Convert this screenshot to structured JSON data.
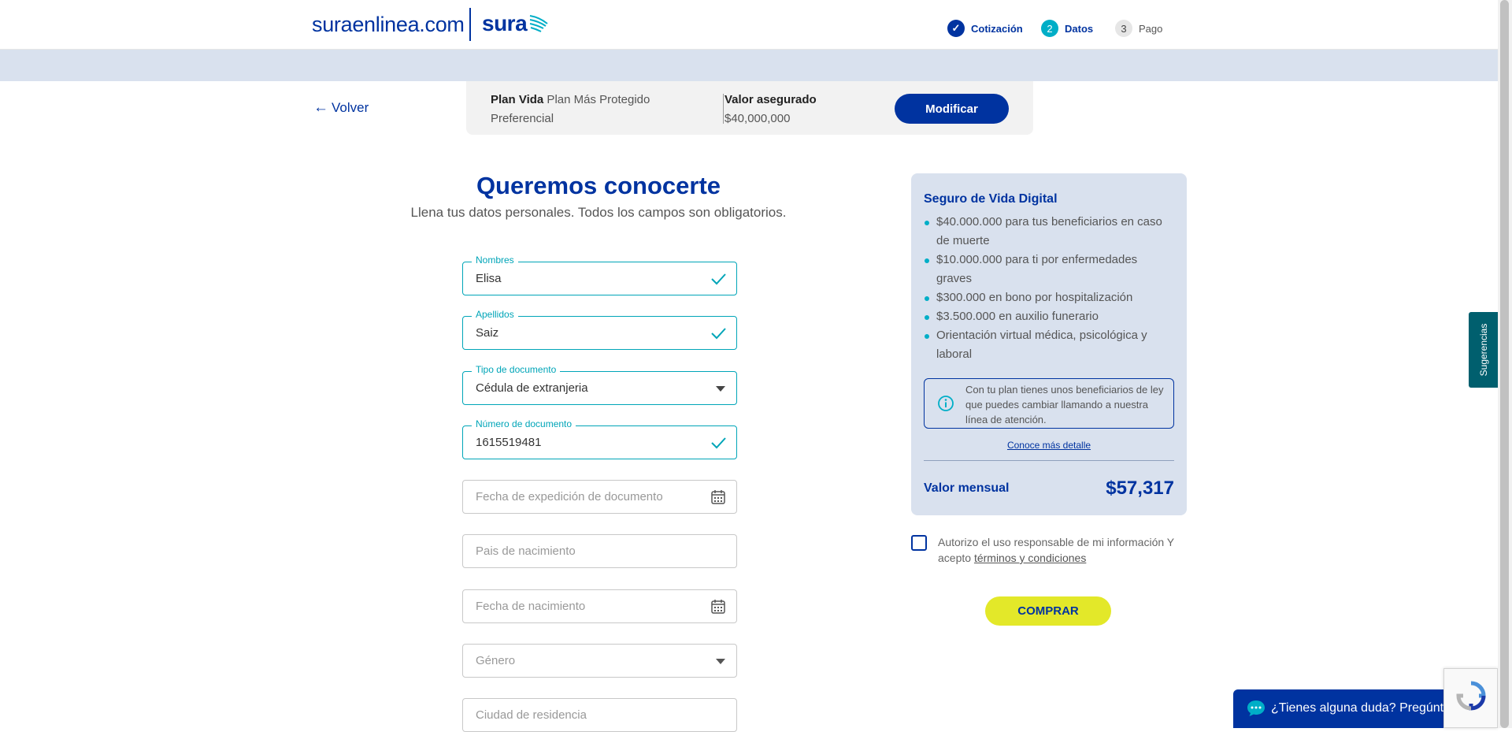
{
  "header": {
    "logo_text": "suraenlinea.com",
    "logo_brand": "sura",
    "steps": [
      {
        "number": "✓",
        "label": "Cotización"
      },
      {
        "number": "2",
        "label": "Datos"
      },
      {
        "number": "3",
        "label": "Pago"
      }
    ]
  },
  "nav": {
    "back_label": "Volver"
  },
  "plan": {
    "name_bold": "Plan Vida",
    "name_rest": " Plan Más Protegido Preferencial",
    "value_label": "Valor asegurado",
    "value": "$40,000,000",
    "modify_label": "Modificar"
  },
  "form": {
    "title": "Queremos conocerte",
    "subtitle": "Llena tus datos personales. Todos los campos son obligatorios.",
    "fields": [
      {
        "label": "Nombres",
        "value": "Elisa"
      },
      {
        "label": "Apellidos",
        "value": "Saiz"
      },
      {
        "label": "Tipo de documento",
        "value": "Cédula de extranjeria"
      },
      {
        "label": "Número de documento",
        "value": "1615519481"
      },
      {
        "placeholder": "Fecha de expedición de documento"
      },
      {
        "placeholder": "Pais de nacimiento"
      },
      {
        "placeholder": "Fecha de nacimiento"
      },
      {
        "placeholder": "Género"
      },
      {
        "placeholder": "Ciudad de residencia"
      }
    ]
  },
  "card": {
    "title": "Seguro de Vida Digital",
    "benefits": [
      "$40.000.000 para tus beneficiarios en caso de muerte",
      "$10.000.000 para ti por enfermedades graves",
      "$300.000 en bono por hospitalización",
      "$3.500.000 en auxilio funerario",
      "Orientación virtual médica, psicológica y laboral"
    ],
    "info": "Con tu plan tienes unos beneficiarios de ley que puedes cambiar llamando a nuestra línea de atención.",
    "more_link": "Conoce más detalle",
    "monthly_label": "Valor mensual",
    "monthly_value": "$57,317"
  },
  "consent": {
    "text": "Autorizo el uso responsable de mi información Y acepto ",
    "link": "términos y condiciones"
  },
  "buy_label": "COMPRAR",
  "side_tab": "Sugerencias",
  "chat": "¿Tienes alguna duda? Pregúntanos",
  "colors": {
    "primary": "#0033a0",
    "accent": "#00aec7",
    "buy": "#e3e829",
    "band": "#d9e1ee"
  }
}
